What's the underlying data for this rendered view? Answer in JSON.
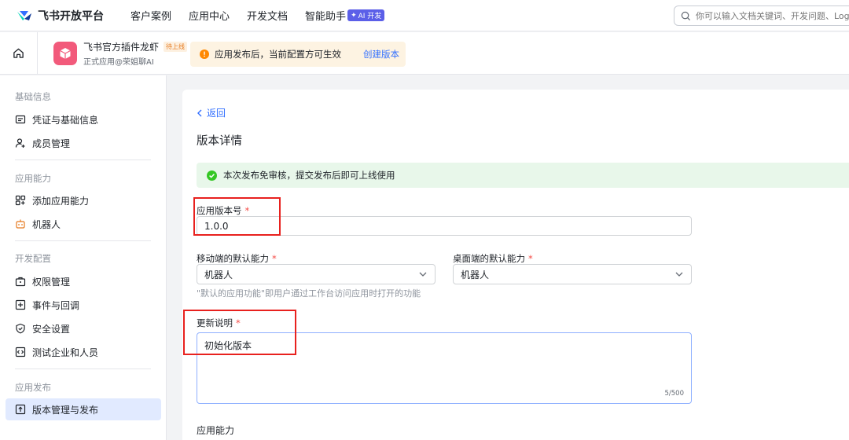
{
  "nav": {
    "brand": "飞书开放平台",
    "links": [
      "客户案例",
      "应用中心",
      "开发文档",
      "智能助手"
    ],
    "ai_badge": "AI 开发",
    "search_placeholder": "你可以输入文档关键词、开发问题、Log"
  },
  "app": {
    "name": "飞书官方插件龙虾",
    "status_badge": "待上线",
    "subtitle": "正式应用@荣姐聊AI",
    "notice_text": "应用发布后，当前配置方可生效",
    "notice_link": "创建版本"
  },
  "sidebar": {
    "groups": [
      {
        "title": "基础信息",
        "items": [
          "凭证与基础信息",
          "成员管理"
        ]
      },
      {
        "title": "应用能力",
        "items": [
          "添加应用能力",
          "机器人"
        ]
      },
      {
        "title": "开发配置",
        "items": [
          "权限管理",
          "事件与回调",
          "安全设置",
          "测试企业和人员"
        ]
      },
      {
        "title": "应用发布",
        "items": [
          "版本管理与发布"
        ]
      }
    ]
  },
  "main": {
    "back": "返回",
    "title": "版本详情",
    "success_banner": "本次发布免审核，提交发布后即可上线使用",
    "version_label": "应用版本号",
    "version_value": "1.0.0",
    "mobile_label": "移动端的默认能力",
    "mobile_value": "机器人",
    "desktop_label": "桌面端的默认能力",
    "desktop_value": "机器人",
    "hint": "\"默认的应用功能\"即用户通过工作台访问应用时打开的功能",
    "notes_label": "更新说明",
    "notes_value": "初始化版本",
    "notes_counter": "5/500",
    "capabilities_title": "应用能力",
    "required_mark": "*"
  },
  "colors": {
    "accent": "#3370ff",
    "required": "#f54a45",
    "highlight": "#e8211e",
    "success_bg": "#e8f7ea",
    "notice_bg": "#fdf3e2",
    "app_icon": "#f25a7b"
  }
}
